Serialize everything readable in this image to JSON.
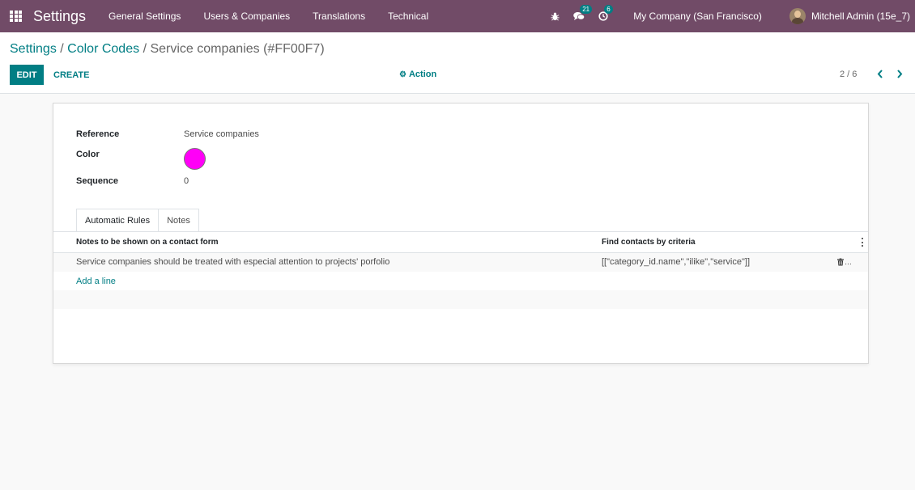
{
  "navbar": {
    "brand": "Settings",
    "menu": [
      "General Settings",
      "Users & Companies",
      "Translations",
      "Technical"
    ],
    "messages_count": "21",
    "activities_count": "6",
    "company": "My Company (San Francisco)",
    "user": "Mitchell Admin (15e_7)",
    "bg_color": "#714B67"
  },
  "breadcrumb": {
    "root": "Settings",
    "parent": "Color Codes",
    "current": "Service companies (#FF00F7)",
    "separator": "/"
  },
  "controls": {
    "edit_label": "EDIT",
    "create_label": "CREATE",
    "action_label": "Action",
    "pager": "2 / 6"
  },
  "form": {
    "reference_label": "Reference",
    "reference_value": "Service companies",
    "color_label": "Color",
    "color_value": "#FF00F7",
    "sequence_label": "Sequence",
    "sequence_value": "0"
  },
  "tabs": [
    "Automatic Rules",
    "Notes"
  ],
  "rules_table": {
    "columns": [
      "Notes to be shown on a contact form",
      "Find contacts by criteria"
    ],
    "rows": [
      {
        "note": "Service companies should be treated with especial attention to projects' porfolio",
        "criteria": "[[\"category_id.name\",\"ilike\",\"service\"]]"
      }
    ],
    "add_line": "Add a line"
  },
  "accent_color": "#017e84"
}
